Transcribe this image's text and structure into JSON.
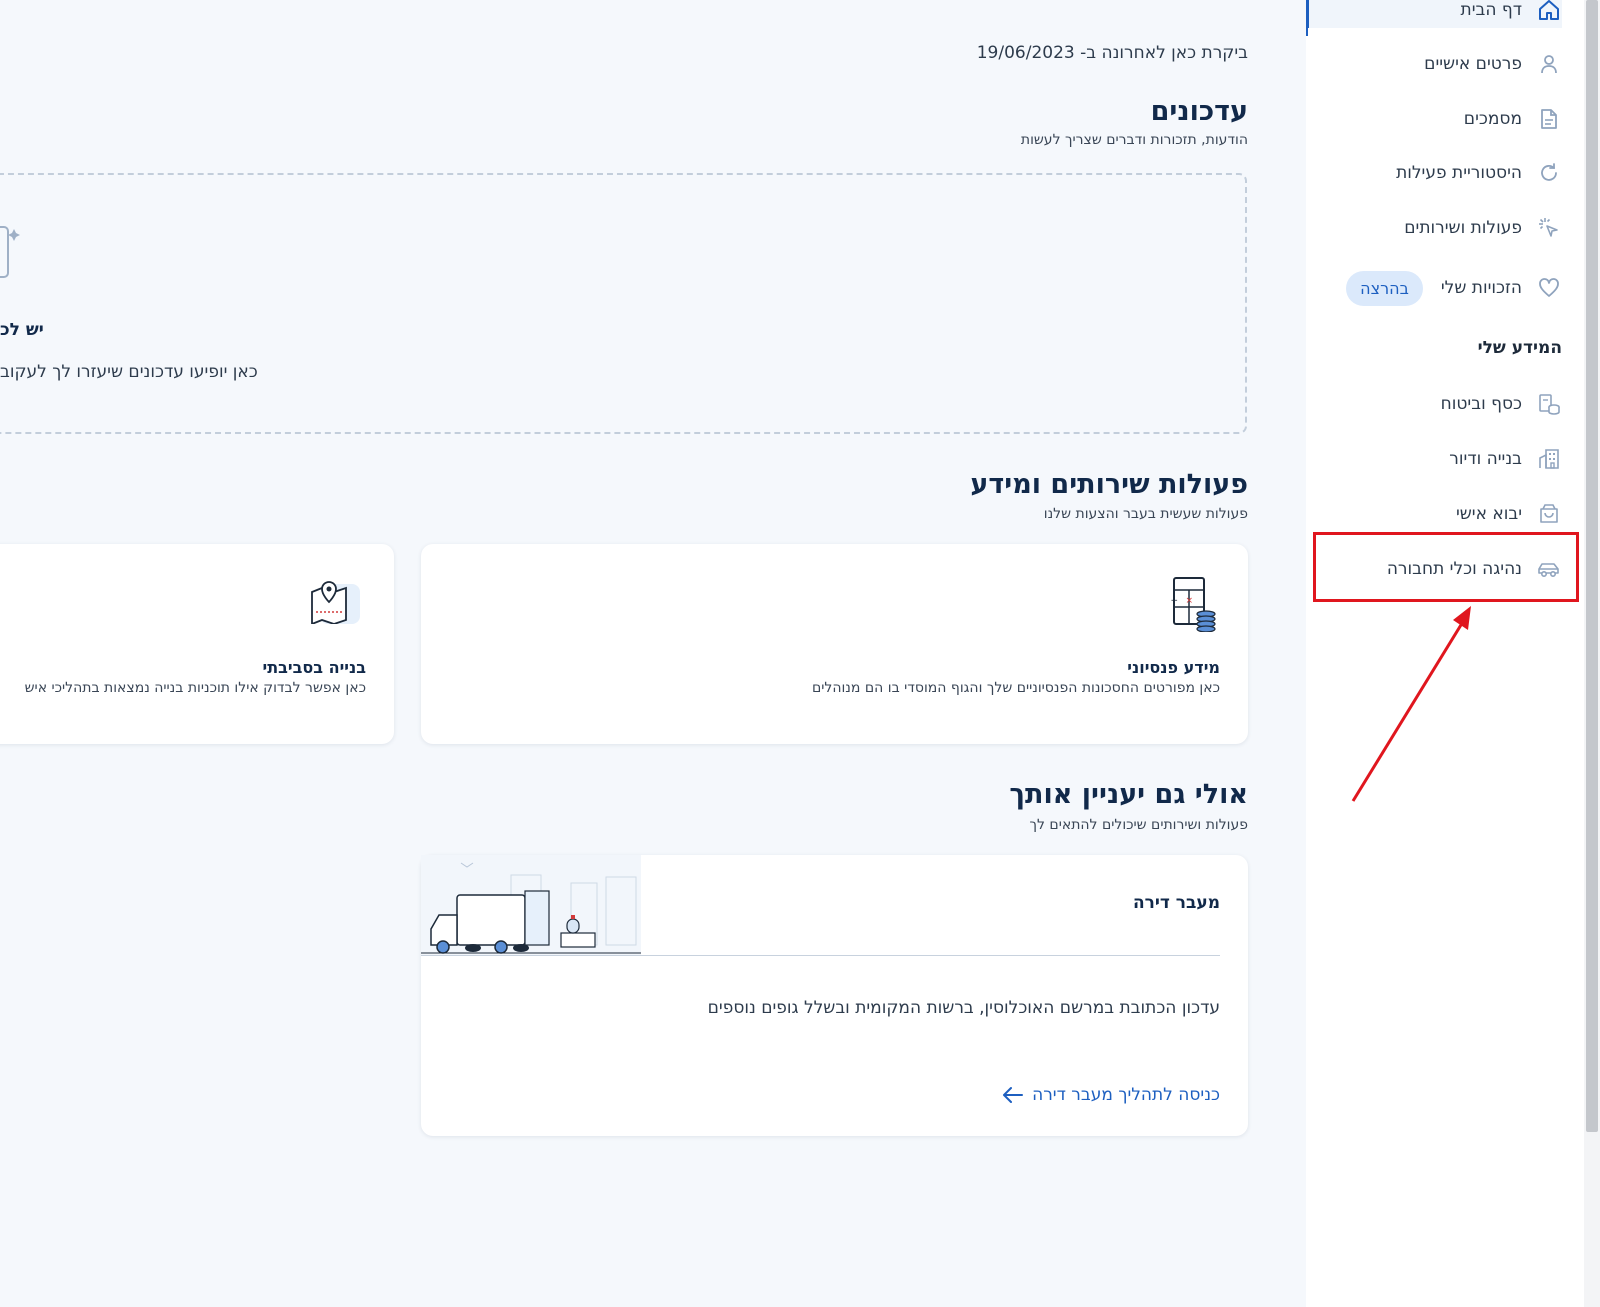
{
  "sidebar": {
    "items": [
      {
        "label": "דף הבית",
        "icon": "home-icon",
        "active": true
      },
      {
        "label": "פרטים אישיים",
        "icon": "user-icon"
      },
      {
        "label": "מסמכים",
        "icon": "document-icon"
      },
      {
        "label": "היסטוריית פעילות",
        "icon": "history-icon"
      },
      {
        "label": "פעולות ושירותים",
        "icon": "pointer-click-icon"
      },
      {
        "label": "הזכויות שלי",
        "icon": "heart-icon",
        "badge": "בהרצה"
      }
    ],
    "section_title": "המידע שלי",
    "info_items": [
      {
        "label": "כסף וביטוח",
        "icon": "coins-icon"
      },
      {
        "label": "בנייה ודיור",
        "icon": "building-icon"
      },
      {
        "label": "יבוא אישי",
        "icon": "shopping-bag-icon"
      },
      {
        "label": "נהיגה וכלי תחבורה",
        "icon": "car-icon"
      }
    ]
  },
  "main": {
    "last_visit": "ביקרת כאן לאחרונה ב- 19/06/2023",
    "updates": {
      "title": "עדכונים",
      "subtitle": "הודעות, תזכורות ודברים שצריך לעשות",
      "empty_title_partial": "יש לכ",
      "empty_text_partial": "כאן יופיעו עדכונים שיעזרו לך לעקוב"
    },
    "services": {
      "title": "פעולות שירותים ומידע",
      "subtitle": "פעולות שעשית בעבר והצעות שלנו",
      "cards": [
        {
          "title": "מידע פנסיוני",
          "desc": "כאן מפורטים החסכונות הפנסיוניים שלך והגוף המוסדי בו הם מנוהלים",
          "icon": "pension-calculator-icon"
        },
        {
          "title": "בנייה בסביבתי",
          "desc": "כאן אפשר לבדוק אילו תוכניות בנייה נמצאות בתהליכי איש",
          "icon": "map-pin-icon"
        }
      ]
    },
    "maybe": {
      "title": "אולי גם יעניין אותך",
      "subtitle": "פעולות ושירותים שיכולים להתאים לך",
      "card": {
        "title": "מעבר דירה",
        "desc": "עדכון הכתובת במרשם האוכלוסין, ברשות המקומית ובשלל גופים נוספים",
        "link": "כניסה לתהליך מעבר דירה"
      }
    }
  },
  "colors": {
    "accent": "#1d5fc0",
    "annotation": "#e0161e",
    "background": "#f5f8fc"
  }
}
